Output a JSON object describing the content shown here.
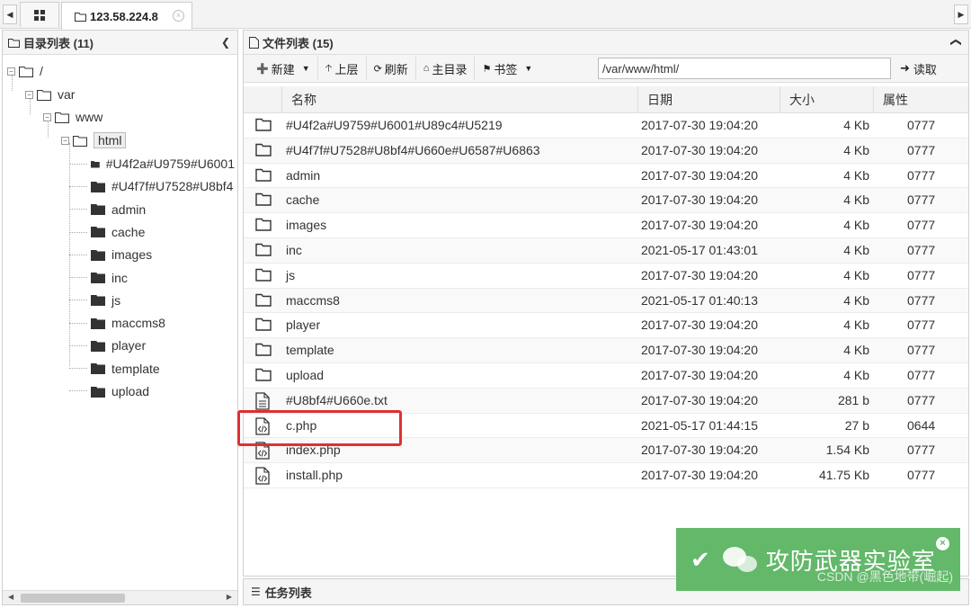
{
  "tabbar": {
    "active_tab": "123.58.224.8",
    "close_glyph": "×",
    "home_icon": "grid-icon"
  },
  "left": {
    "title": "目录列表 (11)",
    "root": "/",
    "nodes": {
      "var": "var",
      "www": "www",
      "html": "html",
      "children": [
        "#U4f2a#U9759#U6001",
        "#U4f7f#U7528#U8bf4",
        "admin",
        "cache",
        "images",
        "inc",
        "js",
        "maccms8",
        "player",
        "template",
        "upload"
      ]
    }
  },
  "right": {
    "title": "文件列表 (15)",
    "toolbar": {
      "new": "新建",
      "up": "上层",
      "refresh": "刷新",
      "home": "主目录",
      "bookmark": "书签",
      "path": "/var/www/html/",
      "read": "读取"
    },
    "columns": {
      "name": "名称",
      "date": "日期",
      "size": "大小",
      "attr": "属性"
    },
    "files": [
      {
        "type": "folder",
        "name": "#U4f2a#U9759#U6001#U89c4#U5219",
        "date": "2017-07-30 19:04:20",
        "size": "4 Kb",
        "attr": "0777"
      },
      {
        "type": "folder",
        "name": "#U4f7f#U7528#U8bf4#U660e#U6587#U6863",
        "date": "2017-07-30 19:04:20",
        "size": "4 Kb",
        "attr": "0777"
      },
      {
        "type": "folder",
        "name": "admin",
        "date": "2017-07-30 19:04:20",
        "size": "4 Kb",
        "attr": "0777"
      },
      {
        "type": "folder",
        "name": "cache",
        "date": "2017-07-30 19:04:20",
        "size": "4 Kb",
        "attr": "0777"
      },
      {
        "type": "folder",
        "name": "images",
        "date": "2017-07-30 19:04:20",
        "size": "4 Kb",
        "attr": "0777"
      },
      {
        "type": "folder",
        "name": "inc",
        "date": "2021-05-17 01:43:01",
        "size": "4 Kb",
        "attr": "0777"
      },
      {
        "type": "folder",
        "name": "js",
        "date": "2017-07-30 19:04:20",
        "size": "4 Kb",
        "attr": "0777"
      },
      {
        "type": "folder",
        "name": "maccms8",
        "date": "2021-05-17 01:40:13",
        "size": "4 Kb",
        "attr": "0777"
      },
      {
        "type": "folder",
        "name": "player",
        "date": "2017-07-30 19:04:20",
        "size": "4 Kb",
        "attr": "0777"
      },
      {
        "type": "folder",
        "name": "template",
        "date": "2017-07-30 19:04:20",
        "size": "4 Kb",
        "attr": "0777"
      },
      {
        "type": "folder",
        "name": "upload",
        "date": "2017-07-30 19:04:20",
        "size": "4 Kb",
        "attr": "0777"
      },
      {
        "type": "text",
        "name": "#U8bf4#U660e.txt",
        "date": "2017-07-30 19:04:20",
        "size": "281 b",
        "attr": "0777"
      },
      {
        "type": "code",
        "name": "c.php",
        "date": "2021-05-17 01:44:15",
        "size": "27 b",
        "attr": "0644"
      },
      {
        "type": "code",
        "name": "index.php",
        "date": "2017-07-30 19:04:20",
        "size": "1.54 Kb",
        "attr": "0777"
      },
      {
        "type": "code",
        "name": "install.php",
        "date": "2017-07-30 19:04:20",
        "size": "41.75 Kb",
        "attr": "0777"
      }
    ]
  },
  "taskbar": {
    "title": "任务列表"
  },
  "toast": {
    "message": "攻防武器实验室",
    "close_glyph": "×"
  },
  "watermark": "CSDN @黑色地带(崛起)",
  "colors": {
    "toast_bg": "#63b86a",
    "highlight": "#e03030"
  }
}
